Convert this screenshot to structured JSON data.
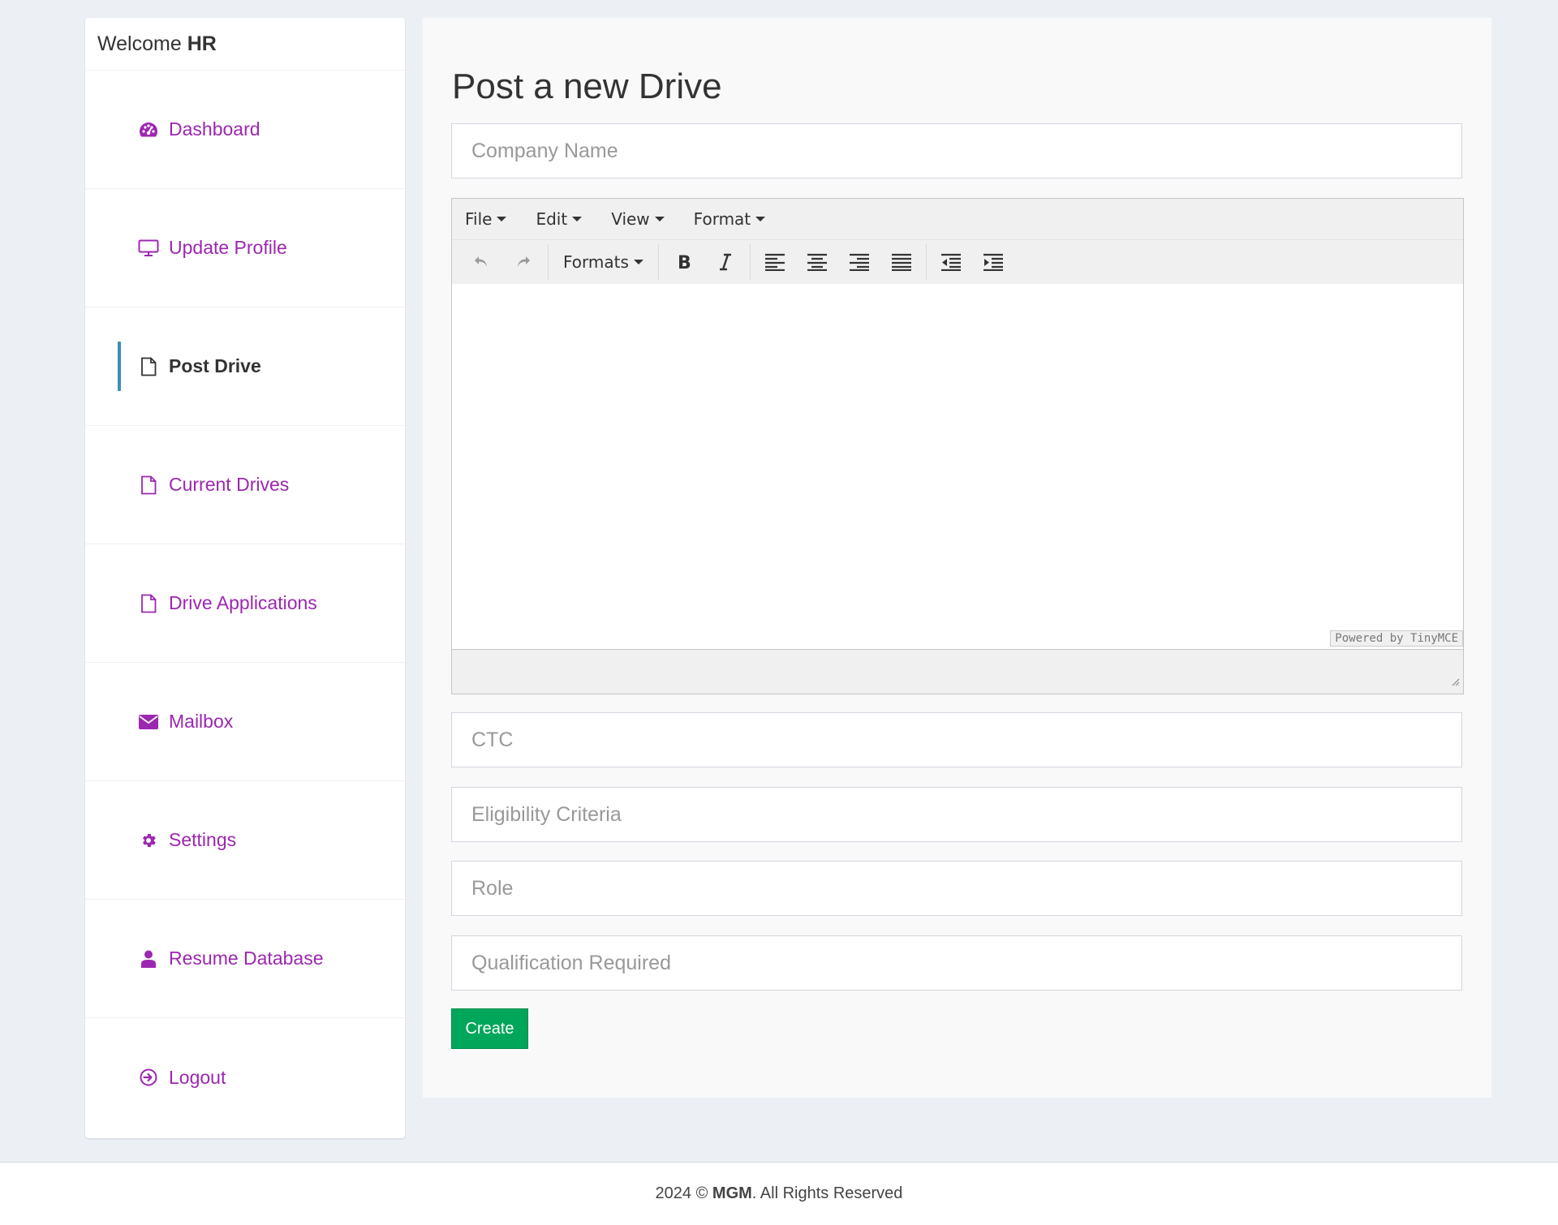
{
  "sidebar": {
    "welcome_prefix": "Welcome",
    "welcome_user": "HR",
    "items": [
      {
        "label": "Dashboard",
        "icon": "dashboard-icon"
      },
      {
        "label": "Update Profile",
        "icon": "monitor-icon"
      },
      {
        "label": "Post Drive",
        "icon": "file-icon",
        "active": true
      },
      {
        "label": "Current Drives",
        "icon": "file-icon"
      },
      {
        "label": "Drive Applications",
        "icon": "file-icon"
      },
      {
        "label": "Mailbox",
        "icon": "envelope-icon"
      },
      {
        "label": "Settings",
        "icon": "gear-icon"
      },
      {
        "label": "Resume Database",
        "icon": "user-icon"
      },
      {
        "label": "Logout",
        "icon": "logout-icon"
      }
    ]
  },
  "main": {
    "title": "Post a new Drive",
    "company_placeholder": "Company Name",
    "ctc_placeholder": "CTC",
    "eligibility_placeholder": "Eligibility Criteria",
    "role_placeholder": "Role",
    "qualification_placeholder": "Qualification Required",
    "create_label": "Create"
  },
  "editor": {
    "menus": [
      "File",
      "Edit",
      "View",
      "Format"
    ],
    "formats_label": "Formats",
    "powered_by": "Powered by TinyMCE"
  },
  "footer": {
    "year": "2024 ©",
    "brand": "MGM",
    "rest": ". All Rights Reserved"
  },
  "colors": {
    "accent": "#9c27b0",
    "active_bar": "#3c8dbc",
    "create_button": "#00a65a",
    "background": "#ecf0f5"
  }
}
